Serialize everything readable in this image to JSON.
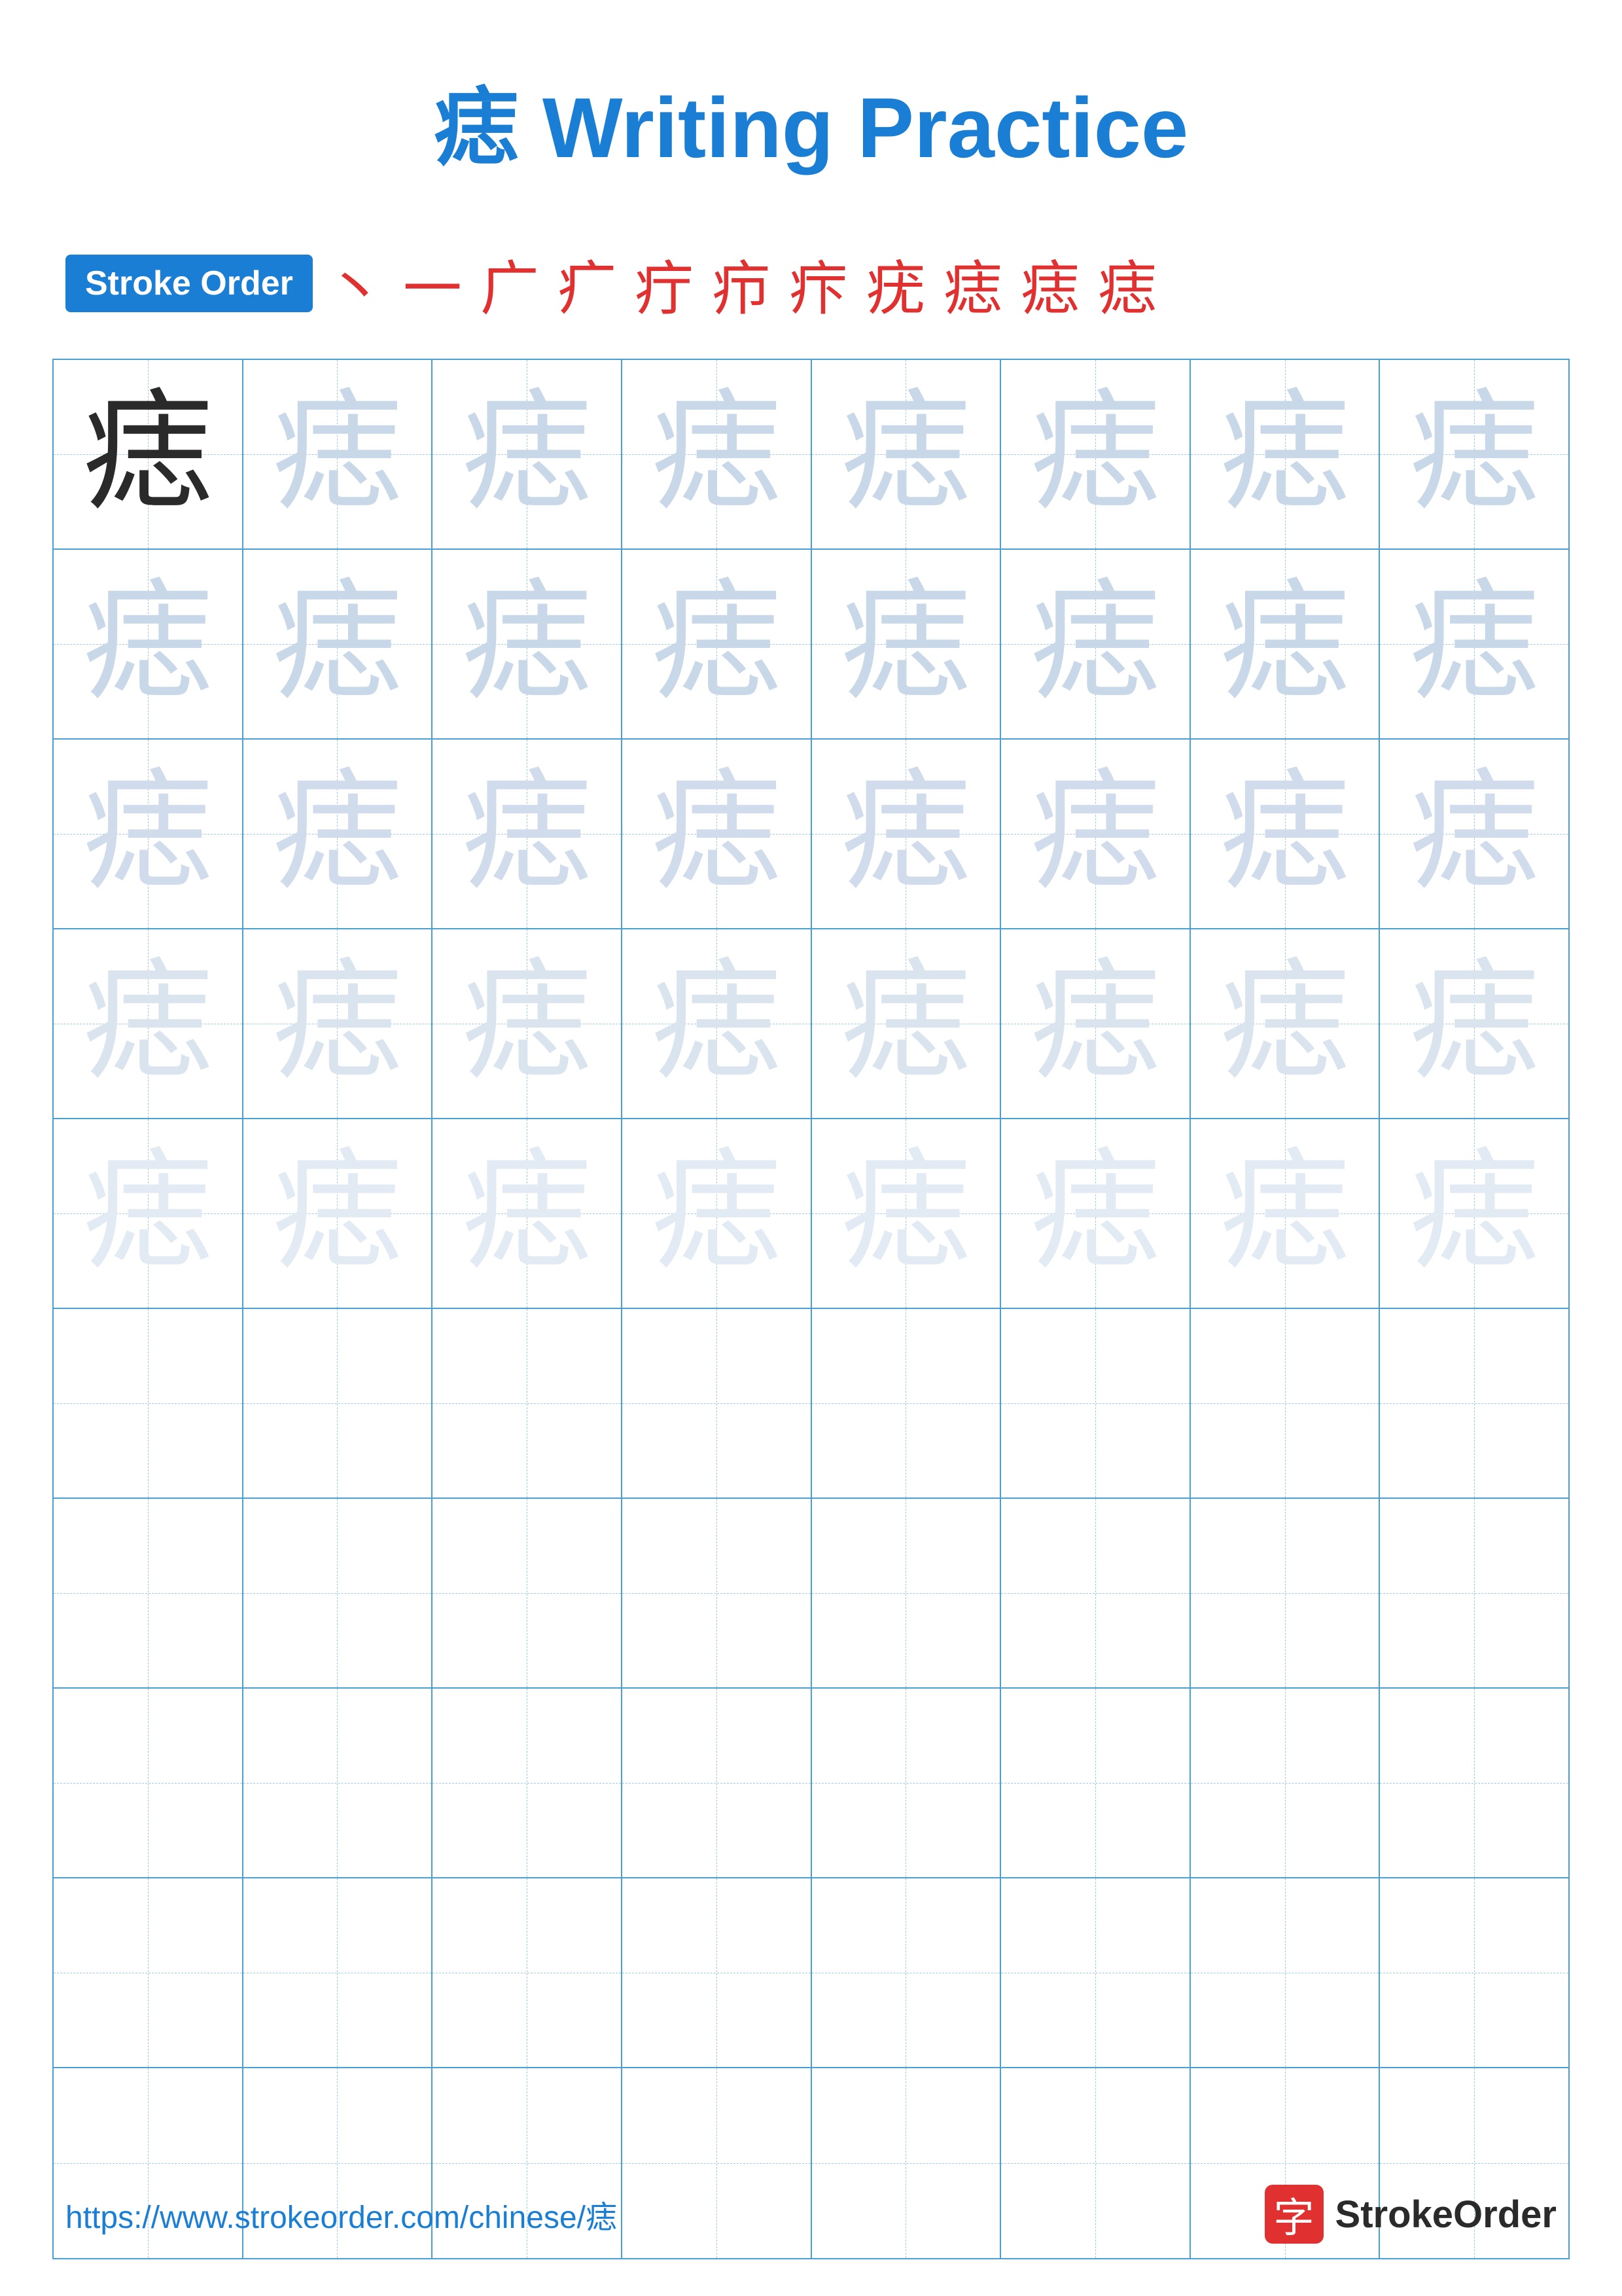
{
  "header": {
    "chinese_char": "痣",
    "title": " Writing Practice"
  },
  "stroke_order": {
    "badge_label": "Stroke Order",
    "strokes": [
      "丶",
      "一",
      "广",
      "疒",
      "疔",
      "疖",
      "疜",
      "疣",
      "痣",
      "痣",
      "痣"
    ]
  },
  "grid": {
    "rows": 10,
    "cols": 8,
    "char": "痣"
  },
  "footer": {
    "url": "https://www.strokeorder.com/chinese/痣",
    "logo_char": "字",
    "logo_text": "StrokeOrder"
  }
}
